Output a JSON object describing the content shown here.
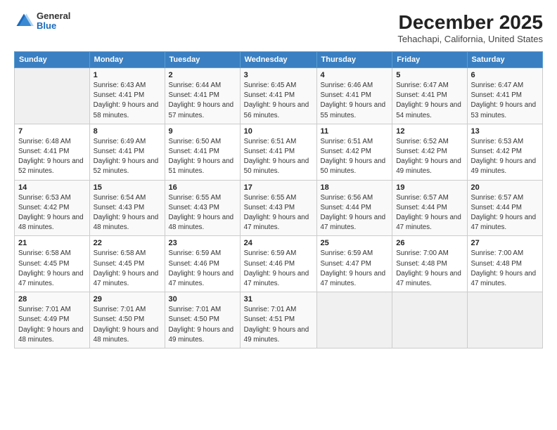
{
  "header": {
    "logo": {
      "general": "General",
      "blue": "Blue"
    },
    "title": "December 2025",
    "subtitle": "Tehachapi, California, United States"
  },
  "calendar": {
    "days_of_week": [
      "Sunday",
      "Monday",
      "Tuesday",
      "Wednesday",
      "Thursday",
      "Friday",
      "Saturday"
    ],
    "weeks": [
      [
        {
          "day": "",
          "info": ""
        },
        {
          "day": "1",
          "info": "Sunrise: 6:43 AM\nSunset: 4:41 PM\nDaylight: 9 hours\nand 58 minutes."
        },
        {
          "day": "2",
          "info": "Sunrise: 6:44 AM\nSunset: 4:41 PM\nDaylight: 9 hours\nand 57 minutes."
        },
        {
          "day": "3",
          "info": "Sunrise: 6:45 AM\nSunset: 4:41 PM\nDaylight: 9 hours\nand 56 minutes."
        },
        {
          "day": "4",
          "info": "Sunrise: 6:46 AM\nSunset: 4:41 PM\nDaylight: 9 hours\nand 55 minutes."
        },
        {
          "day": "5",
          "info": "Sunrise: 6:47 AM\nSunset: 4:41 PM\nDaylight: 9 hours\nand 54 minutes."
        },
        {
          "day": "6",
          "info": "Sunrise: 6:47 AM\nSunset: 4:41 PM\nDaylight: 9 hours\nand 53 minutes."
        }
      ],
      [
        {
          "day": "7",
          "info": "Sunrise: 6:48 AM\nSunset: 4:41 PM\nDaylight: 9 hours\nand 52 minutes."
        },
        {
          "day": "8",
          "info": "Sunrise: 6:49 AM\nSunset: 4:41 PM\nDaylight: 9 hours\nand 52 minutes."
        },
        {
          "day": "9",
          "info": "Sunrise: 6:50 AM\nSunset: 4:41 PM\nDaylight: 9 hours\nand 51 minutes."
        },
        {
          "day": "10",
          "info": "Sunrise: 6:51 AM\nSunset: 4:41 PM\nDaylight: 9 hours\nand 50 minutes."
        },
        {
          "day": "11",
          "info": "Sunrise: 6:51 AM\nSunset: 4:42 PM\nDaylight: 9 hours\nand 50 minutes."
        },
        {
          "day": "12",
          "info": "Sunrise: 6:52 AM\nSunset: 4:42 PM\nDaylight: 9 hours\nand 49 minutes."
        },
        {
          "day": "13",
          "info": "Sunrise: 6:53 AM\nSunset: 4:42 PM\nDaylight: 9 hours\nand 49 minutes."
        }
      ],
      [
        {
          "day": "14",
          "info": "Sunrise: 6:53 AM\nSunset: 4:42 PM\nDaylight: 9 hours\nand 48 minutes."
        },
        {
          "day": "15",
          "info": "Sunrise: 6:54 AM\nSunset: 4:43 PM\nDaylight: 9 hours\nand 48 minutes."
        },
        {
          "day": "16",
          "info": "Sunrise: 6:55 AM\nSunset: 4:43 PM\nDaylight: 9 hours\nand 48 minutes."
        },
        {
          "day": "17",
          "info": "Sunrise: 6:55 AM\nSunset: 4:43 PM\nDaylight: 9 hours\nand 47 minutes."
        },
        {
          "day": "18",
          "info": "Sunrise: 6:56 AM\nSunset: 4:44 PM\nDaylight: 9 hours\nand 47 minutes."
        },
        {
          "day": "19",
          "info": "Sunrise: 6:57 AM\nSunset: 4:44 PM\nDaylight: 9 hours\nand 47 minutes."
        },
        {
          "day": "20",
          "info": "Sunrise: 6:57 AM\nSunset: 4:44 PM\nDaylight: 9 hours\nand 47 minutes."
        }
      ],
      [
        {
          "day": "21",
          "info": "Sunrise: 6:58 AM\nSunset: 4:45 PM\nDaylight: 9 hours\nand 47 minutes."
        },
        {
          "day": "22",
          "info": "Sunrise: 6:58 AM\nSunset: 4:45 PM\nDaylight: 9 hours\nand 47 minutes."
        },
        {
          "day": "23",
          "info": "Sunrise: 6:59 AM\nSunset: 4:46 PM\nDaylight: 9 hours\nand 47 minutes."
        },
        {
          "day": "24",
          "info": "Sunrise: 6:59 AM\nSunset: 4:46 PM\nDaylight: 9 hours\nand 47 minutes."
        },
        {
          "day": "25",
          "info": "Sunrise: 6:59 AM\nSunset: 4:47 PM\nDaylight: 9 hours\nand 47 minutes."
        },
        {
          "day": "26",
          "info": "Sunrise: 7:00 AM\nSunset: 4:48 PM\nDaylight: 9 hours\nand 47 minutes."
        },
        {
          "day": "27",
          "info": "Sunrise: 7:00 AM\nSunset: 4:48 PM\nDaylight: 9 hours\nand 47 minutes."
        }
      ],
      [
        {
          "day": "28",
          "info": "Sunrise: 7:01 AM\nSunset: 4:49 PM\nDaylight: 9 hours\nand 48 minutes."
        },
        {
          "day": "29",
          "info": "Sunrise: 7:01 AM\nSunset: 4:50 PM\nDaylight: 9 hours\nand 48 minutes."
        },
        {
          "day": "30",
          "info": "Sunrise: 7:01 AM\nSunset: 4:50 PM\nDaylight: 9 hours\nand 49 minutes."
        },
        {
          "day": "31",
          "info": "Sunrise: 7:01 AM\nSunset: 4:51 PM\nDaylight: 9 hours\nand 49 minutes."
        },
        {
          "day": "",
          "info": ""
        },
        {
          "day": "",
          "info": ""
        },
        {
          "day": "",
          "info": ""
        }
      ]
    ]
  }
}
